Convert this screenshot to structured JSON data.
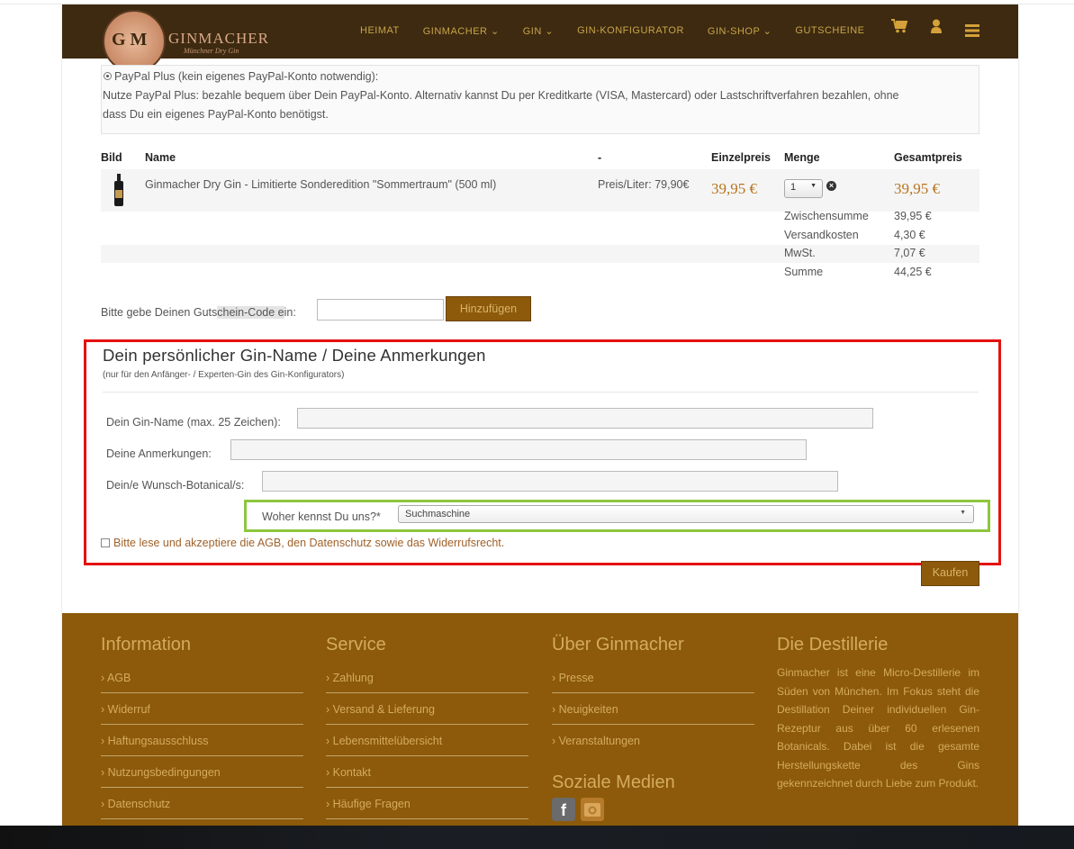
{
  "header": {
    "logo_text": "GINMACHER",
    "logo_sub": "Münchner Dry Gin",
    "logo_gm": "G M",
    "nav": [
      "HEIMAT",
      "GINMACHER ⌄",
      "GIN ⌄",
      "GIN-KONFIGURATOR",
      "GIN-SHOP ⌄",
      "GUTSCHEINE"
    ],
    "icons": [
      "cart-icon",
      "user-icon",
      "menu-icon"
    ]
  },
  "paypal": {
    "option": "PayPal Plus (kein eigenes PayPal-Konto notwendig):",
    "desc1": "Nutze PayPal Plus: bezahle bequem über Dein PayPal-Konto. Alternativ kannst Du per Kreditkarte (VISA, Mastercard) oder Lastschriftverfahren bezahlen, ohne",
    "desc2": "dass Du ein eigenes PayPal-Konto benötigst."
  },
  "cart": {
    "headers": {
      "image": "Bild",
      "name": "Name",
      "dash": "-",
      "unit": "Einzelpreis",
      "qty": "Menge",
      "total": "Gesamtpreis"
    },
    "item": {
      "name": "Ginmacher Dry Gin - Limitierte Sonderedition \"Sommertraum\" (500 ml)",
      "per_liter": "Preis/Liter: 79,90€",
      "unit_price": "39,95 €",
      "qty": "1",
      "total": "39,95 €"
    },
    "summary": [
      {
        "label": "Zwischensumme",
        "value": "39,95 €"
      },
      {
        "label": "Versandkosten",
        "value": "4,30 €"
      },
      {
        "label": "MwSt.",
        "value": "7,07 €"
      },
      {
        "label": "Summe",
        "value": "44,25 €"
      }
    ]
  },
  "coupon": {
    "label_a": "Bitte gebe Deinen Guts",
    "label_b": "chein-Code e",
    "label_c": "in:",
    "value": "",
    "button": "Hinzufügen"
  },
  "form": {
    "title": "Dein persönlicher Gin-Name / Deine Anmerkungen",
    "subtitle": "(nur für den Anfänger- / Experten-Gin des Gin-Konfigurators)",
    "gin_name_label": "Dein Gin-Name (max. 25 Zeichen):",
    "gin_name_value": "",
    "notes_label": "Deine Anmerkungen:",
    "notes_value": "",
    "botanical_label": "Dein/e Wunsch-Botanical/s:",
    "botanical_value": "",
    "source_label": "Woher kennst Du uns?*",
    "source_value": "Suchmaschine",
    "agb_text": "Bitte lese und akzeptiere die AGB, den Datenschutz sowie das Widerrufsrecht.",
    "buy_button": "Kaufen"
  },
  "footer": {
    "information": {
      "title": "Information",
      "links": [
        "AGB",
        "Widerruf",
        "Haftungsausschluss",
        "Nutzungsbedingungen",
        "Datenschutz"
      ]
    },
    "service": {
      "title": "Service",
      "links": [
        "Zahlung",
        "Versand & Lieferung",
        "Lebensmittelübersicht",
        "Kontakt",
        "Häufige Fragen"
      ]
    },
    "about": {
      "title": "Über Ginmacher",
      "links": [
        "Presse",
        "Neuigkeiten",
        "Veranstaltungen"
      ]
    },
    "social_title": "Soziale Medien",
    "destillerie": {
      "title": "Die Destillerie",
      "text": "Ginmacher ist eine Micro-Destillerie im Süden von München. Im Fokus steht die Destillation Deiner individuellen Gin-Rezeptur aus über 60 erlesenen Botanicals. Dabei ist die gesamte Herstellungskette des Gins gekennzeichnet durch Liebe zum Produkt."
    },
    "colors": {
      "bg": "#8c5a0a",
      "text": "#d5ab5e"
    }
  }
}
